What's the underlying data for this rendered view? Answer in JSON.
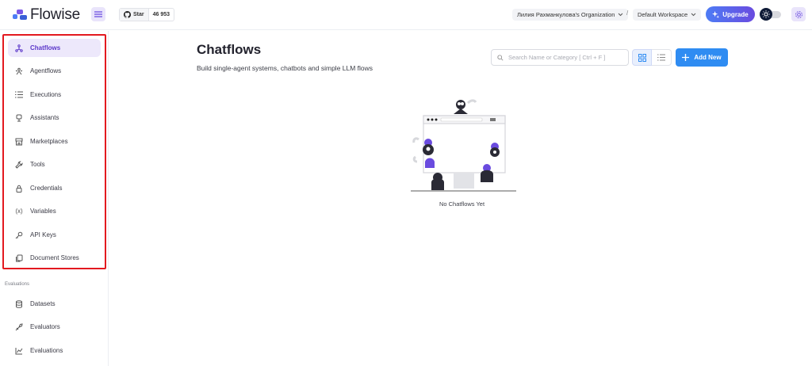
{
  "app": {
    "name": "Flowise"
  },
  "header": {
    "github": {
      "star_label": "Star",
      "star_count": "46 953"
    },
    "organization": "Лилия Рахманкулова's Organization",
    "separator": "/",
    "workspace": "Default Workspace",
    "upgrade_label": "Upgrade"
  },
  "sidebar": {
    "items": [
      {
        "label": "Chatflows",
        "icon": "chatflow-icon",
        "active": true
      },
      {
        "label": "Agentflows",
        "icon": "agentflow-icon"
      },
      {
        "label": "Executions",
        "icon": "list-icon"
      },
      {
        "label": "Assistants",
        "icon": "robot-icon"
      },
      {
        "label": "Marketplaces",
        "icon": "store-icon"
      },
      {
        "label": "Tools",
        "icon": "tool-icon"
      },
      {
        "label": "Credentials",
        "icon": "lock-icon"
      },
      {
        "label": "Variables",
        "icon": "variable-icon"
      },
      {
        "label": "API Keys",
        "icon": "key-icon"
      },
      {
        "label": "Document Stores",
        "icon": "files-icon"
      }
    ],
    "section_title": "Evaluations",
    "eval_items": [
      {
        "label": "Datasets",
        "icon": "database-icon"
      },
      {
        "label": "Evaluators",
        "icon": "evaluator-icon"
      },
      {
        "label": "Evaluations",
        "icon": "chart-icon"
      }
    ]
  },
  "main": {
    "title": "Chatflows",
    "subtitle": "Build single-agent systems, chatbots and simple LLM flows",
    "search_placeholder": "Search Name or Category [ Ctrl + F ]",
    "add_label": "Add New",
    "empty_text": "No Chatflows Yet"
  },
  "colors": {
    "accent": "#2f8cf2",
    "active_bg": "#ede8fb",
    "active_fg": "#5b36c9",
    "highlight": "#e3191f"
  }
}
